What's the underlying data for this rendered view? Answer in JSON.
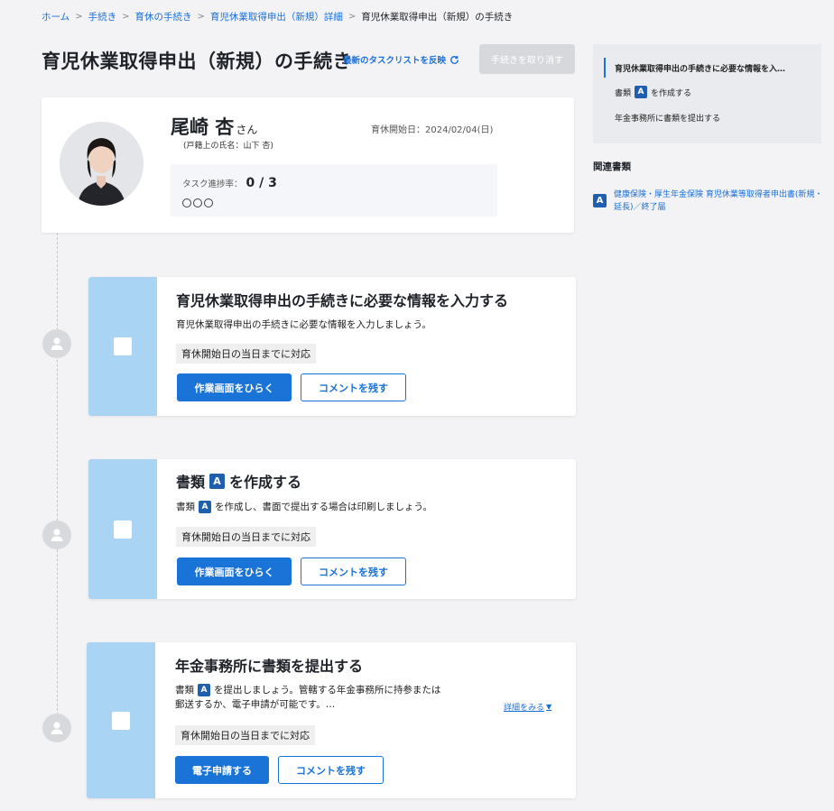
{
  "breadcrumb": {
    "items": [
      "ホーム",
      "手続き",
      "育休の手続き",
      "育児休業取得申出（新規）詳細",
      "育児休業取得申出（新規）の手続き"
    ],
    "separator": ">"
  },
  "header": {
    "title": "育児休業取得申出（新規）の手続き",
    "refresh_label": "最新のタスクリストを反映",
    "cancel_label": "手続きを取り消す"
  },
  "profile": {
    "name": "尾崎 杏",
    "honorific": "さん",
    "legal_name": "(戸籍上の氏名：山下 杏)",
    "leave_start": "育休開始日：2024/02/04(日)",
    "progress_label": "タスク進捗率：",
    "progress_value": "0 / 3",
    "progress_done": 0,
    "progress_total": 3
  },
  "tasks": [
    {
      "title": "育児休業取得申出の手続きに必要な情報を入力する",
      "description": "育児休業取得申出の手続きに必要な情報を入力しましょう。",
      "deadline": "育休開始日の当日までに対応",
      "primary_label": "作業画面をひらく",
      "secondary_label": "コメントを残す"
    },
    {
      "title_prefix": "書類",
      "title_badge": "A",
      "title_suffix": "を作成する",
      "desc_prefix": "書類",
      "desc_badge": "A",
      "desc_suffix": "を作成し、書面で提出する場合は印刷しましょう。",
      "deadline": "育休開始日の当日までに対応",
      "primary_label": "作業画面をひらく",
      "secondary_label": "コメントを残す"
    },
    {
      "title": "年金事務所に書類を提出する",
      "desc_prefix": "書類",
      "desc_badge": "A",
      "desc_line1_suffix": "を提出しましょう。管轄する年金事務所に持参または",
      "desc_line2": "郵送するか、電子申請が可能です。…",
      "details_label": "詳細をみる",
      "deadline": "育休開始日の当日までに対応",
      "primary_label": "電子申請する",
      "secondary_label": "コメントを残す"
    }
  ],
  "right_panel": {
    "steps": [
      {
        "label": "育児休業取得申出の手続きに必要な情報を入…"
      },
      {
        "prefix": "書類",
        "badge": "A",
        "suffix": "を作成する"
      },
      {
        "label": "年金事務所に書類を提出する"
      }
    ],
    "related_heading": "関連書類",
    "related_doc_badge": "A",
    "related_doc_label": "健康保険・厚生年金保険 育児休業等取得者申出書(新規・延長)／終了届"
  },
  "colors": {
    "accent": "#1a73d6",
    "task_side": "#a9d4f4",
    "doc_badge": "#1f5fae",
    "disabled_button": "#d6d8dc"
  },
  "icons": {
    "refresh": "refresh-icon",
    "timeline": "person-icon",
    "details": "caret-down-icon"
  }
}
